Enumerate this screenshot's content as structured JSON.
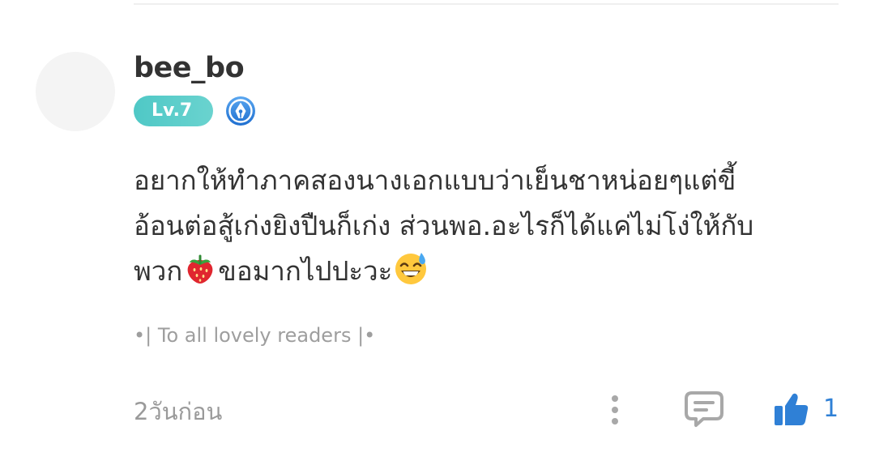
{
  "comment": {
    "username": "bee_bo",
    "level_badge": "Lv.7",
    "writer_badge_icon": "fountain-pen-icon",
    "text_lines": [
      "อยากให้ทำภาคสองนางเอกแบบว่าเย็นชาหน่อยๆแต่ขี้",
      "อ้อนต่อสู้เก่งยิงปืนก็เก่ง ส่วนพอ.อะไรก็ได้แค่ไม่โง่ให้กับ",
      "พวก",
      "ขอมากไปปะวะ"
    ],
    "emojis": [
      "strawberry-emoji",
      "grinning-sweat-emoji"
    ],
    "signature": "•| To all lovely readers |•",
    "timestamp": "2วันก่อน",
    "like_count": "1"
  },
  "actions": {
    "more_icon": "vertical-dots-icon",
    "reply_icon": "comment-bubble-icon",
    "like_icon": "thumbs-up-icon"
  },
  "colors": {
    "level_badge": "#55cbc8",
    "accent_blue": "#2f80d6",
    "text_primary": "#333333",
    "text_secondary": "#9a9a9a"
  }
}
